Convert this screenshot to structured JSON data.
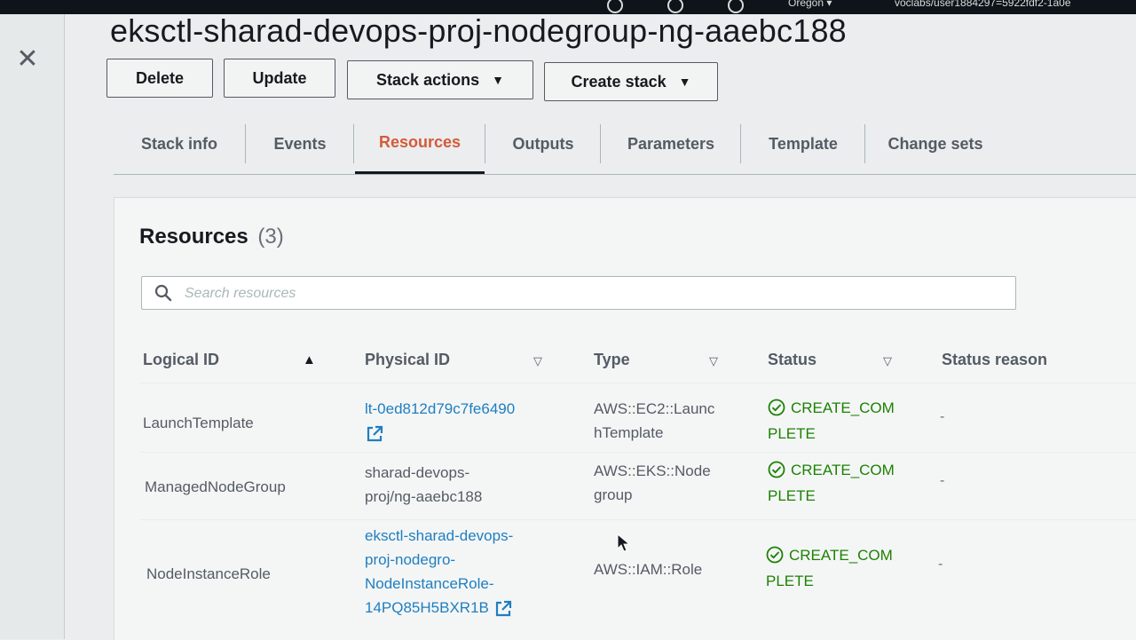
{
  "topbar": {
    "region": "Oregon ▾",
    "user": "voclabs/user1884297=5922fdf2-1a0e"
  },
  "page": {
    "title": "eksctl-sharad-devops-proj-nodegroup-ng-aaebc188"
  },
  "actions": {
    "delete": "Delete",
    "update": "Update",
    "stack_actions": "Stack actions",
    "create_stack": "Create stack"
  },
  "tabs": [
    {
      "label": "Stack info"
    },
    {
      "label": "Events"
    },
    {
      "label": "Resources",
      "active": true
    },
    {
      "label": "Outputs"
    },
    {
      "label": "Parameters"
    },
    {
      "label": "Template"
    },
    {
      "label": "Change sets"
    }
  ],
  "resources": {
    "title": "Resources",
    "count": "(3)",
    "search_placeholder": "Search resources",
    "columns": {
      "logical_id": "Logical ID",
      "physical_id": "Physical ID",
      "type": "Type",
      "status": "Status",
      "status_reason": "Status reason"
    },
    "rows": [
      {
        "logical_id": "LaunchTemplate",
        "physical_id": "lt-0ed812d79c7fe6490",
        "type": [
          "AWS::EC2::Launc",
          "hTemplate"
        ],
        "status": [
          "CREATE_COM",
          "PLETE"
        ],
        "reason": "-"
      },
      {
        "logical_id": "ManagedNodeGroup",
        "physical_id": [
          "sharad-devops-",
          "proj/ng-aaebc188"
        ],
        "type": [
          "AWS::EKS::Node",
          "group"
        ],
        "status": [
          "CREATE_COM",
          "PLETE"
        ],
        "reason": "-"
      },
      {
        "logical_id": "NodeInstanceRole",
        "physical_id": [
          "eksctl-sharad-devops-",
          "proj-nodegro-",
          "NodeInstanceRole-",
          "14PQ85H5BXR1B"
        ],
        "type": "AWS::IAM::Role",
        "status": [
          "CREATE_COM",
          "PLETE"
        ],
        "reason": "-"
      }
    ]
  },
  "colors": {
    "accent_tab": "#d45b3a",
    "link": "#1f7ec1",
    "success": "#1d8102"
  }
}
